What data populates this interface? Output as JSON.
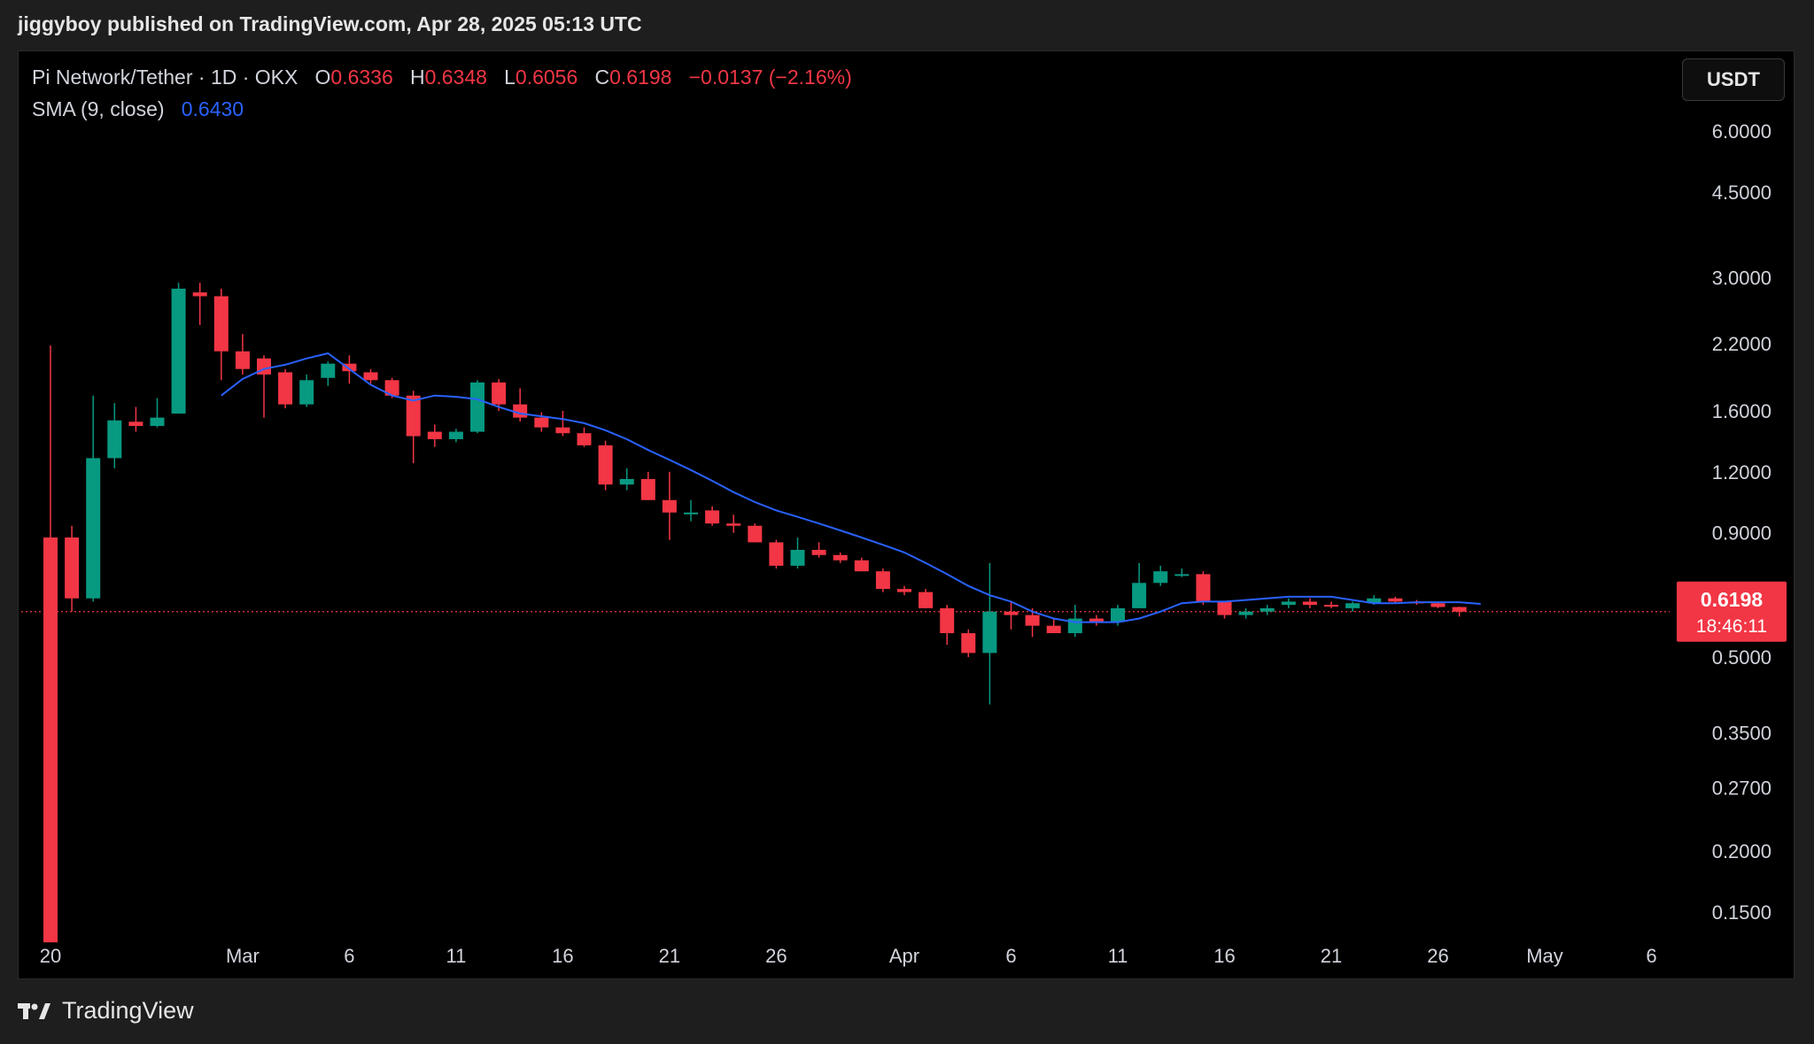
{
  "header": {
    "publish_line": "jiggyboy published on TradingView.com, Apr 28, 2025 05:13 UTC"
  },
  "legend": {
    "symbol": "Pi Network/Tether · 1D · OKX",
    "o_label": "O",
    "o_value": "0.6336",
    "h_label": "H",
    "h_value": "0.6348",
    "l_label": "L",
    "l_value": "0.6056",
    "c_label": "C",
    "c_value": "0.6198",
    "change": "−0.0137 (−2.16%)",
    "sma_label": "SMA (9, close)",
    "sma_value": "0.6430"
  },
  "currency_button": "USDT",
  "price_tag": {
    "price": "0.6198",
    "countdown": "18:46:11"
  },
  "footer": {
    "brand": "TradingView"
  },
  "colors": {
    "up": "#089981",
    "down": "#f23645",
    "sma": "#2962ff",
    "background": "#000000"
  },
  "chart_data": {
    "type": "candlestick",
    "scale": "log",
    "y_ticks": [
      6.0,
      4.5,
      3.0,
      2.2,
      1.6,
      1.2,
      0.9,
      0.5,
      0.35,
      0.27,
      0.2,
      0.15
    ],
    "y_tick_labels": [
      "6.0000",
      "4.5000",
      "3.0000",
      "2.2000",
      "1.6000",
      "1.2000",
      "0.9000",
      "0.5000",
      "0.3500",
      "0.2700",
      "0.2000",
      "0.1500"
    ],
    "x_tick_labels": [
      {
        "label": "20",
        "index": 0
      },
      {
        "label": "Mar",
        "index": 9
      },
      {
        "label": "6",
        "index": 14
      },
      {
        "label": "11",
        "index": 19
      },
      {
        "label": "16",
        "index": 24
      },
      {
        "label": "21",
        "index": 29
      },
      {
        "label": "26",
        "index": 34
      },
      {
        "label": "Apr",
        "index": 40
      },
      {
        "label": "6",
        "index": 45
      },
      {
        "label": "11",
        "index": 50
      },
      {
        "label": "16",
        "index": 55
      },
      {
        "label": "21",
        "index": 60
      },
      {
        "label": "26",
        "index": 65
      },
      {
        "label": "May",
        "index": 70
      },
      {
        "label": "6",
        "index": 75
      }
    ],
    "ylim": [
      0.13,
      7.0
    ],
    "last_price": 0.6198,
    "candles": [
      {
        "o": 0.88,
        "h": 2.18,
        "l": 0.13,
        "c": 0.13
      },
      {
        "o": 0.88,
        "h": 0.93,
        "l": 0.62,
        "c": 0.66
      },
      {
        "o": 0.66,
        "h": 1.72,
        "l": 0.65,
        "c": 1.28
      },
      {
        "o": 1.28,
        "h": 1.66,
        "l": 1.22,
        "c": 1.53
      },
      {
        "o": 1.52,
        "h": 1.63,
        "l": 1.45,
        "c": 1.49
      },
      {
        "o": 1.49,
        "h": 1.7,
        "l": 1.48,
        "c": 1.55
      },
      {
        "o": 1.58,
        "h": 2.93,
        "l": 1.58,
        "c": 2.85
      },
      {
        "o": 2.8,
        "h": 2.93,
        "l": 2.4,
        "c": 2.75
      },
      {
        "o": 2.75,
        "h": 2.85,
        "l": 1.85,
        "c": 2.12
      },
      {
        "o": 2.12,
        "h": 2.3,
        "l": 1.9,
        "c": 1.95
      },
      {
        "o": 2.05,
        "h": 2.08,
        "l": 1.55,
        "c": 1.9
      },
      {
        "o": 1.92,
        "h": 1.95,
        "l": 1.62,
        "c": 1.65
      },
      {
        "o": 1.65,
        "h": 1.9,
        "l": 1.63,
        "c": 1.85
      },
      {
        "o": 1.87,
        "h": 2.02,
        "l": 1.8,
        "c": 2.0
      },
      {
        "o": 2.0,
        "h": 2.08,
        "l": 1.82,
        "c": 1.93
      },
      {
        "o": 1.92,
        "h": 1.95,
        "l": 1.82,
        "c": 1.85
      },
      {
        "o": 1.85,
        "h": 1.87,
        "l": 1.7,
        "c": 1.72
      },
      {
        "o": 1.72,
        "h": 1.76,
        "l": 1.25,
        "c": 1.42
      },
      {
        "o": 1.45,
        "h": 1.5,
        "l": 1.35,
        "c": 1.4
      },
      {
        "o": 1.4,
        "h": 1.47,
        "l": 1.38,
        "c": 1.45
      },
      {
        "o": 1.45,
        "h": 1.85,
        "l": 1.44,
        "c": 1.83
      },
      {
        "o": 1.83,
        "h": 1.86,
        "l": 1.6,
        "c": 1.65
      },
      {
        "o": 1.65,
        "h": 1.78,
        "l": 1.52,
        "c": 1.55
      },
      {
        "o": 1.55,
        "h": 1.59,
        "l": 1.45,
        "c": 1.48
      },
      {
        "o": 1.48,
        "h": 1.6,
        "l": 1.42,
        "c": 1.44
      },
      {
        "o": 1.44,
        "h": 1.48,
        "l": 1.35,
        "c": 1.36
      },
      {
        "o": 1.36,
        "h": 1.39,
        "l": 1.1,
        "c": 1.13
      },
      {
        "o": 1.13,
        "h": 1.22,
        "l": 1.1,
        "c": 1.16
      },
      {
        "o": 1.16,
        "h": 1.2,
        "l": 1.05,
        "c": 1.05
      },
      {
        "o": 1.05,
        "h": 1.2,
        "l": 0.87,
        "c": 0.99
      },
      {
        "o": 0.99,
        "h": 1.05,
        "l": 0.95,
        "c": 0.99
      },
      {
        "o": 1.0,
        "h": 1.02,
        "l": 0.93,
        "c": 0.94
      },
      {
        "o": 0.94,
        "h": 0.98,
        "l": 0.9,
        "c": 0.93
      },
      {
        "o": 0.93,
        "h": 0.94,
        "l": 0.86,
        "c": 0.86
      },
      {
        "o": 0.86,
        "h": 0.87,
        "l": 0.76,
        "c": 0.77
      },
      {
        "o": 0.77,
        "h": 0.88,
        "l": 0.76,
        "c": 0.83
      },
      {
        "o": 0.83,
        "h": 0.86,
        "l": 0.8,
        "c": 0.81
      },
      {
        "o": 0.81,
        "h": 0.82,
        "l": 0.78,
        "c": 0.79
      },
      {
        "o": 0.79,
        "h": 0.8,
        "l": 0.75,
        "c": 0.75
      },
      {
        "o": 0.75,
        "h": 0.76,
        "l": 0.68,
        "c": 0.69
      },
      {
        "o": 0.69,
        "h": 0.7,
        "l": 0.67,
        "c": 0.68
      },
      {
        "o": 0.68,
        "h": 0.69,
        "l": 0.63,
        "c": 0.63
      },
      {
        "o": 0.63,
        "h": 0.64,
        "l": 0.53,
        "c": 0.56
      },
      {
        "o": 0.56,
        "h": 0.57,
        "l": 0.5,
        "c": 0.51
      },
      {
        "o": 0.51,
        "h": 0.78,
        "l": 0.4,
        "c": 0.62
      },
      {
        "o": 0.62,
        "h": 0.65,
        "l": 0.57,
        "c": 0.61
      },
      {
        "o": 0.61,
        "h": 0.63,
        "l": 0.55,
        "c": 0.58
      },
      {
        "o": 0.58,
        "h": 0.6,
        "l": 0.56,
        "c": 0.56
      },
      {
        "o": 0.56,
        "h": 0.64,
        "l": 0.55,
        "c": 0.6
      },
      {
        "o": 0.6,
        "h": 0.61,
        "l": 0.58,
        "c": 0.59
      },
      {
        "o": 0.59,
        "h": 0.64,
        "l": 0.58,
        "c": 0.63
      },
      {
        "o": 0.63,
        "h": 0.78,
        "l": 0.63,
        "c": 0.71
      },
      {
        "o": 0.71,
        "h": 0.77,
        "l": 0.7,
        "c": 0.75
      },
      {
        "o": 0.74,
        "h": 0.76,
        "l": 0.73,
        "c": 0.74
      },
      {
        "o": 0.74,
        "h": 0.75,
        "l": 0.64,
        "c": 0.65
      },
      {
        "o": 0.65,
        "h": 0.65,
        "l": 0.6,
        "c": 0.61
      },
      {
        "o": 0.61,
        "h": 0.63,
        "l": 0.6,
        "c": 0.62
      },
      {
        "o": 0.62,
        "h": 0.64,
        "l": 0.61,
        "c": 0.63
      },
      {
        "o": 0.64,
        "h": 0.66,
        "l": 0.63,
        "c": 0.65
      },
      {
        "o": 0.65,
        "h": 0.66,
        "l": 0.63,
        "c": 0.64
      },
      {
        "o": 0.64,
        "h": 0.65,
        "l": 0.63,
        "c": 0.635
      },
      {
        "o": 0.63,
        "h": 0.65,
        "l": 0.62,
        "c": 0.645
      },
      {
        "o": 0.645,
        "h": 0.67,
        "l": 0.64,
        "c": 0.66
      },
      {
        "o": 0.66,
        "h": 0.665,
        "l": 0.645,
        "c": 0.65
      },
      {
        "o": 0.65,
        "h": 0.655,
        "l": 0.64,
        "c": 0.645
      },
      {
        "o": 0.645,
        "h": 0.65,
        "l": 0.63,
        "c": 0.6336
      },
      {
        "o": 0.6336,
        "h": 0.6348,
        "l": 0.6056,
        "c": 0.6198
      }
    ],
    "sma_9": [
      null,
      null,
      null,
      null,
      null,
      null,
      null,
      null,
      1.72,
      1.86,
      1.95,
      1.99,
      2.05,
      2.1,
      1.95,
      1.81,
      1.72,
      1.68,
      1.72,
      1.71,
      1.69,
      1.63,
      1.58,
      1.56,
      1.54,
      1.51,
      1.46,
      1.4,
      1.33,
      1.27,
      1.21,
      1.15,
      1.09,
      1.04,
      1.0,
      0.97,
      0.94,
      0.91,
      0.88,
      0.85,
      0.82,
      0.78,
      0.74,
      0.7,
      0.67,
      0.65,
      0.62,
      0.6,
      0.59,
      0.59,
      0.59,
      0.6,
      0.62,
      0.645,
      0.65,
      0.65,
      0.655,
      0.66,
      0.665,
      0.665,
      0.665,
      0.655,
      0.645,
      0.645,
      0.648,
      0.648,
      0.648,
      0.643
    ]
  }
}
